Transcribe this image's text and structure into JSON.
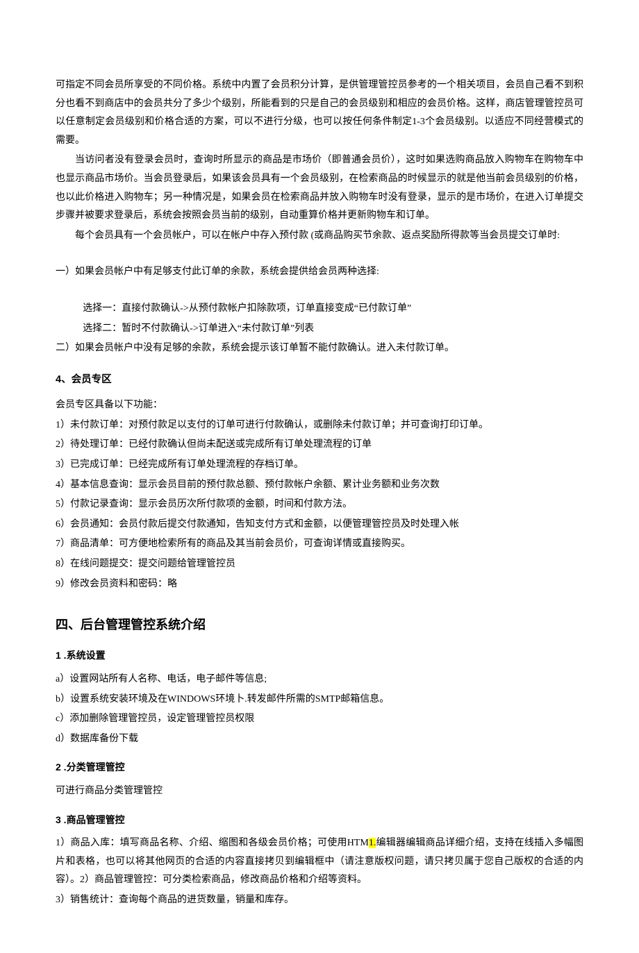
{
  "intro": {
    "p1": "可指定不同会员所享受的不同价格。系统中内置了会员积分计算，是供管理管控员参考的一个相关项目，会员自己看不到积分也看不到商店中的会员共分了多少个级别，所能看到的只是自己的会员级别和相应的会员价格。这样，商店管理管控员可以任意制定会员级别和价格合适的方案，可以不进行分级，也可以按任何条件制定1-3个会员级别。以适应不同经营模式的需要。",
    "p2": "当访问者没有登录会员时，查询时所显示的商品是市场价（即普通会员价），这时如果选购商品放入购物车在购物车中也显示商品市场价。当会员登录后，如果该会员具有一个会员级别，在检索商品的时候显示的就是他当前会员级别的价格，也以此价格进入购物车；另一种情况是，如果会员在检索商品并放入购物车时没有登录，显示的是市场价，在进入订单提交步骤并被要求登录后，系统会按照会员当前的级别，自动重算价格并更新购物车和订单。",
    "p3": "每个会员具有一个会员帐户，可以在帐户中存入预付款 (或商品购买节余款、返点奖励所得款等当会员提交订单时:"
  },
  "cases": {
    "c1": "一）如果会员帐户中有足够支付此订单的余款，系统会提供给会员两种选择:",
    "opt1": "选择一：直接付款确认->从预付款帐户扣除款项，订单直接变成“已付款订单”",
    "opt2": "选择二：暂时不付款确认->订单进入“未付款订单”列表",
    "c2": "二）如果会员帐户中没有足够的余款，系统会提示该订单暂不能付款确认。进入未付款订单。"
  },
  "sec4": {
    "title": "4、会员专区",
    "lead": "会员专区具备以下功能：",
    "i1": "1）未付款订单：对预付款足以支付的订单可进行付款确认，或删除未付款订单；并可查询打印订单。",
    "i2": "2）待处理订单：已经付款确认但尚未配送或完成所有订单处理流程的订单",
    "i3": "3）已完成订单：已经完成所有订单处理流程的存档订单。",
    "i4": "4）基本信息查询：显示会员目前的预付款总额、预付款帐户余额、累计业务额和业务次数",
    "i5": "5）付款记录查询：显示会员历次所付款项的金额，时间和付款方法。",
    "i6": "6）会员通知：会员付款后提交付款通知，告知支付方式和金额，以便管理管控员及时处理入帐",
    "i7": "7）商品清单：可方便地检索所有的商品及其当前会员价，可查询详情或直接购买。",
    "i8": "8）在线问题提交：提交问题给管理管控员",
    "i9": "9）修改会员资料和密码：略"
  },
  "sec_main": {
    "title": "四、后台管理管控系统介绍",
    "s1": {
      "title": "1  .系统设置",
      "a": "a）设置网站所有人名称、电话，电子邮件等信息;",
      "b": "b）设置系统安装环境及在WINDOWS环境卜.转发邮件所需的SMTP邮箱信息。",
      "c": "c）添加删除管理管控员，设定管理管控员权限",
      "d": "d）数据库备份下载"
    },
    "s2": {
      "title": "2  .分类管理管控",
      "body": "可进行商品分类管理管控"
    },
    "s3": {
      "title": "3  .商品管理管控",
      "p1a": "1）商品入库：填写商品名称、介绍、缩图和各级会员价格；可使用HTM",
      "hl": "1.",
      "p1b": "编辑器编辑商品详细介绍，支持在线插入多幅图片和表格，也可以将其他网页的合适的内容直接拷贝到编辑框中（请注意版权问题，请只拷贝属于您自己版权的合适的内容）。2）商品管理管控：可分类检索商品，修改商品价格和介绍等资料。",
      "p2": "3）销售统计：查询每个商品的进货数量，销量和库存。"
    }
  }
}
